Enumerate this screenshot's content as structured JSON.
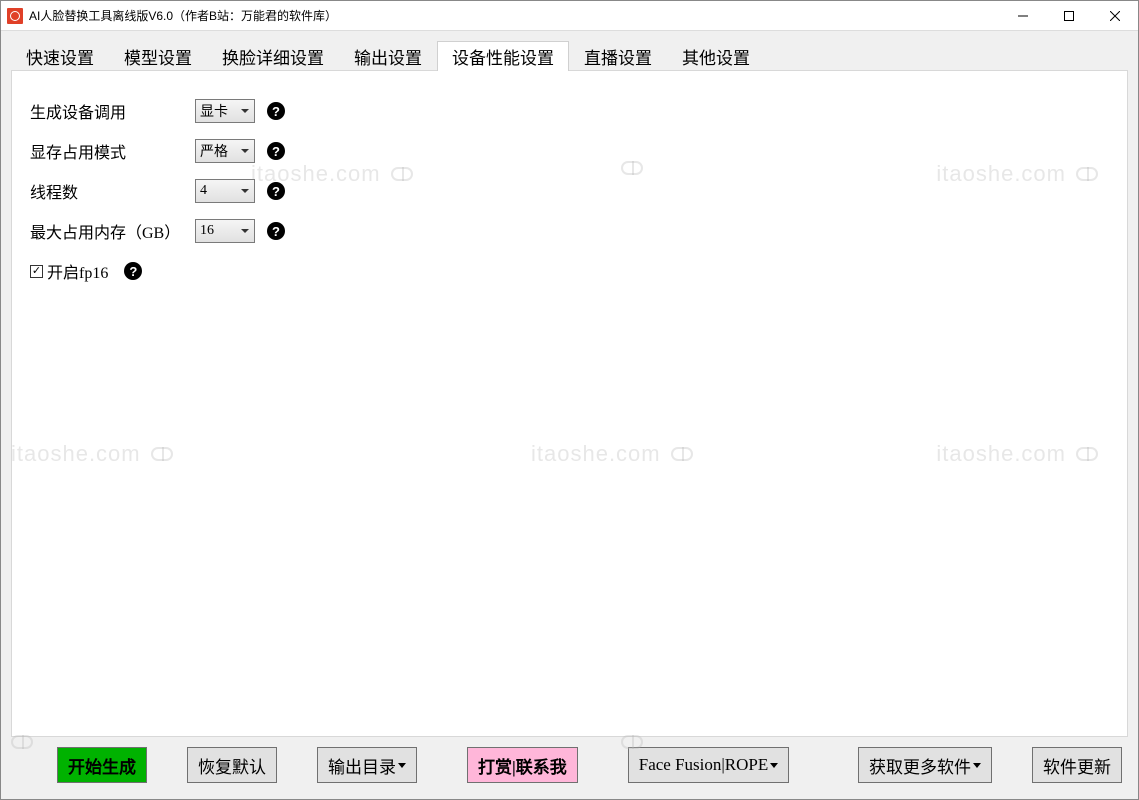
{
  "title": "AI人脸替换工具离线版V6.0（作者B站：万能君的软件库）",
  "tabs": [
    "快速设置",
    "模型设置",
    "换脸详细设置",
    "输出设置",
    "设备性能设置",
    "直播设置",
    "其他设置"
  ],
  "active_tab_index": 4,
  "settings": {
    "device": {
      "label": "生成设备调用",
      "value": "显卡"
    },
    "vram": {
      "label": "显存占用模式",
      "value": "严格"
    },
    "threads": {
      "label": "线程数",
      "value": "4"
    },
    "maxmem": {
      "label": "最大占用内存（GB）",
      "value": "16"
    },
    "fp16": {
      "label": "开启fp16",
      "checked": true
    }
  },
  "buttons": {
    "start": "开始生成",
    "reset": "恢复默认",
    "outdir": "输出目录",
    "donate": "打赏|联系我",
    "facefusion": "Face Fusion|ROPE",
    "moresoft": "获取更多软件",
    "update": "软件更新"
  },
  "watermark": "itaoshe.com"
}
